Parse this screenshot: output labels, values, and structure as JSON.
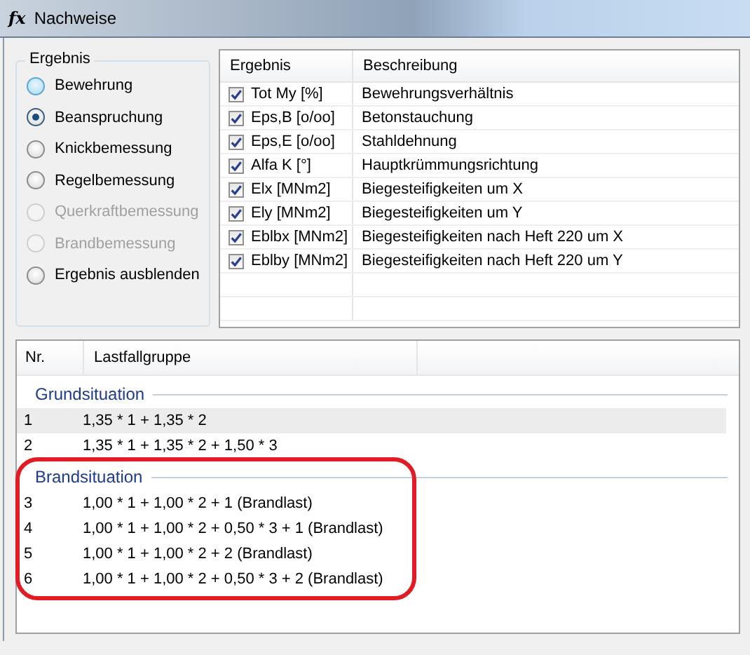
{
  "window": {
    "title": "Nachweise",
    "title_icon": "fx"
  },
  "result_group": {
    "title": "Ergebnis",
    "options": [
      {
        "label": "Bewehrung",
        "selected": false,
        "disabled": false,
        "hovered": true
      },
      {
        "label": "Beanspruchung",
        "selected": true,
        "disabled": false,
        "hovered": false
      },
      {
        "label": "Knickbemessung",
        "selected": false,
        "disabled": false,
        "hovered": false
      },
      {
        "label": "Regelbemessung",
        "selected": false,
        "disabled": false,
        "hovered": false
      },
      {
        "label": "Querkraftbemessung",
        "selected": false,
        "disabled": true,
        "hovered": false
      },
      {
        "label": "Brandbemessung",
        "selected": false,
        "disabled": true,
        "hovered": false
      },
      {
        "label": "Ergebnis ausblenden",
        "selected": false,
        "disabled": false,
        "hovered": false
      }
    ]
  },
  "result_table": {
    "columns": [
      "Ergebnis",
      "Beschreibung"
    ],
    "rows": [
      {
        "result": "Tot My [%]",
        "description": "Bewehrungsverhältnis",
        "checked": true
      },
      {
        "result": "Eps,B [o/oo]",
        "description": "Betonstauchung",
        "checked": true
      },
      {
        "result": "Eps,E [o/oo]",
        "description": "Stahldehnung",
        "checked": true
      },
      {
        "result": "Alfa K [°]",
        "description": "Hauptkrümmungsrichtung",
        "checked": true
      },
      {
        "result": "Elx [MNm2]",
        "description": "Biegesteifigkeiten um X",
        "checked": true
      },
      {
        "result": "Ely [MNm2]",
        "description": "Biegesteifigkeiten um Y",
        "checked": true
      },
      {
        "result": "Eblbx [MNm2]",
        "description": "Biegesteifigkeiten nach Heft 220 um X",
        "checked": true
      },
      {
        "result": "Eblby [MNm2]",
        "description": "Biegesteifigkeiten nach Heft 220 um Y",
        "checked": true
      }
    ]
  },
  "load_list": {
    "columns": [
      "Nr.",
      "Lastfallgruppe"
    ],
    "groups": [
      {
        "title": "Grundsituation",
        "highlighted": false,
        "rows": [
          {
            "nr": "1",
            "combination": "1,35 * 1 + 1,35 * 2",
            "selected": true
          },
          {
            "nr": "2",
            "combination": "1,35 * 1 + 1,35 * 2 + 1,50 * 3",
            "selected": false
          }
        ]
      },
      {
        "title": "Brandsituation",
        "highlighted": true,
        "rows": [
          {
            "nr": "3",
            "combination": "1,00 * 1 + 1,00 * 2 + 1 (Brandlast)",
            "selected": false
          },
          {
            "nr": "4",
            "combination": "1,00 * 1 + 1,00 * 2 + 0,50 * 3 + 1 (Brandlast)",
            "selected": false
          },
          {
            "nr": "5",
            "combination": "1,00 * 1 + 1,00 * 2 + 2 (Brandlast)",
            "selected": false
          },
          {
            "nr": "6",
            "combination": "1,00 * 1 + 1,00 * 2 + 0,50 * 3 + 2 (Brandlast)",
            "selected": false
          }
        ]
      }
    ]
  }
}
